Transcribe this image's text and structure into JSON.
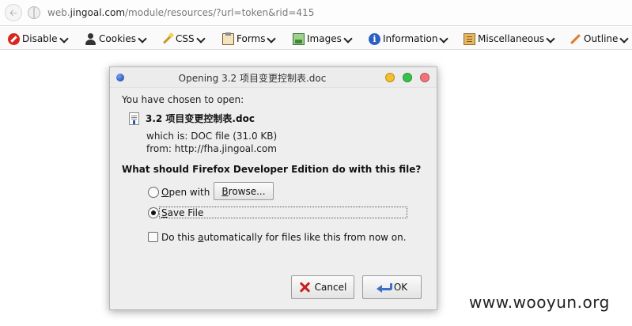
{
  "browser": {
    "url_prefix": "web.",
    "url_domain": "jingoal.com",
    "url_path": "/module/resources/?url=token&rid=415"
  },
  "toolbar": {
    "items": [
      {
        "label": "Disable",
        "icon": "disable-icon"
      },
      {
        "label": "Cookies",
        "icon": "cookies-icon"
      },
      {
        "label": "CSS",
        "icon": "css-icon"
      },
      {
        "label": "Forms",
        "icon": "forms-icon"
      },
      {
        "label": "Images",
        "icon": "images-icon"
      },
      {
        "label": "Information",
        "icon": "information-icon"
      },
      {
        "label": "Miscellaneous",
        "icon": "miscellaneous-icon"
      },
      {
        "label": "Outline",
        "icon": "outline-icon"
      }
    ]
  },
  "dialog": {
    "title": "Opening 3.2 项目变更控制表.doc",
    "chosen_text": "You have chosen to open:",
    "filename": "3.2 项目变更控制表.doc",
    "which_is_label": "which is:",
    "which_is_value": "DOC file (31.0 KB)",
    "from_label": "from:",
    "from_value": "http://fha.jingoal.com",
    "question": "What should Firefox Developer Edition do with this file?",
    "open_with_first": "O",
    "open_with_rest": "pen with",
    "browse_first": "B",
    "browse_rest": "rowse...",
    "save_file_first": "S",
    "save_file_rest": "ave File",
    "auto_prefix": "Do this ",
    "auto_underlined": "a",
    "auto_suffix": "utomatically for files like this from now on.",
    "cancel_label": "Cancel",
    "ok_label": "OK",
    "selected_option": "Save File",
    "auto_checked": false
  },
  "watermark": "www.wooyun.org"
}
